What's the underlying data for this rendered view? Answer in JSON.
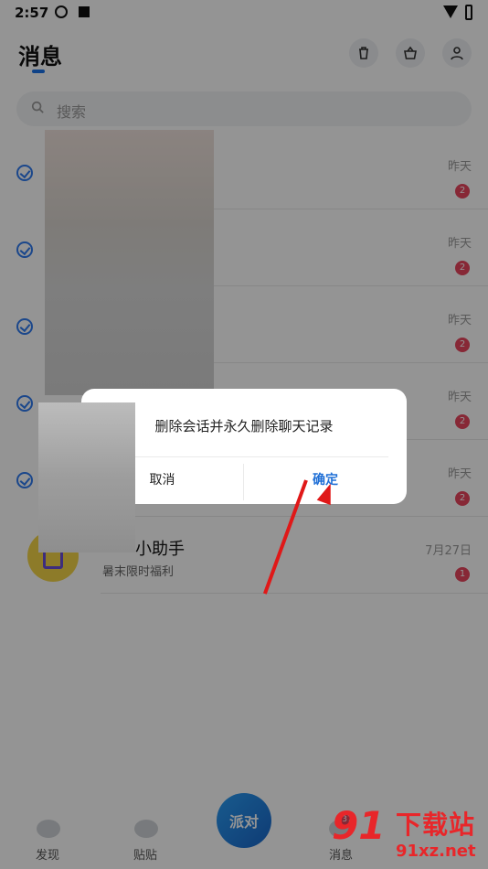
{
  "status_bar": {
    "time": "2:57"
  },
  "header": {
    "title": "消息",
    "icons": [
      "trash-icon",
      "basket-icon",
      "contacts-icon"
    ]
  },
  "search": {
    "placeholder": "搜索"
  },
  "conversations": [
    {
      "time": "昨天",
      "badge": "2"
    },
    {
      "time": "昨天",
      "badge": "2"
    },
    {
      "time": "昨天",
      "badge": "2"
    },
    {
      "time": "昨天",
      "badge": "2"
    },
    {
      "time": "昨天",
      "badge": "2"
    }
  ],
  "helper": {
    "name": "小助手",
    "preview": "暑末限时福利",
    "time": "7月27日",
    "badge": "1"
  },
  "dialog": {
    "message": "删除会话并永久删除聊天记录",
    "cancel_label": "取消",
    "ok_label": "确定"
  },
  "tabbar": {
    "discover_label": "发现",
    "posts_label": "贴贴",
    "center_label": "派对",
    "messages_label": "消息",
    "messages_badge": "37"
  },
  "watermark": {
    "logo": "91",
    "text": "下载站",
    "url": "91xz.net"
  }
}
